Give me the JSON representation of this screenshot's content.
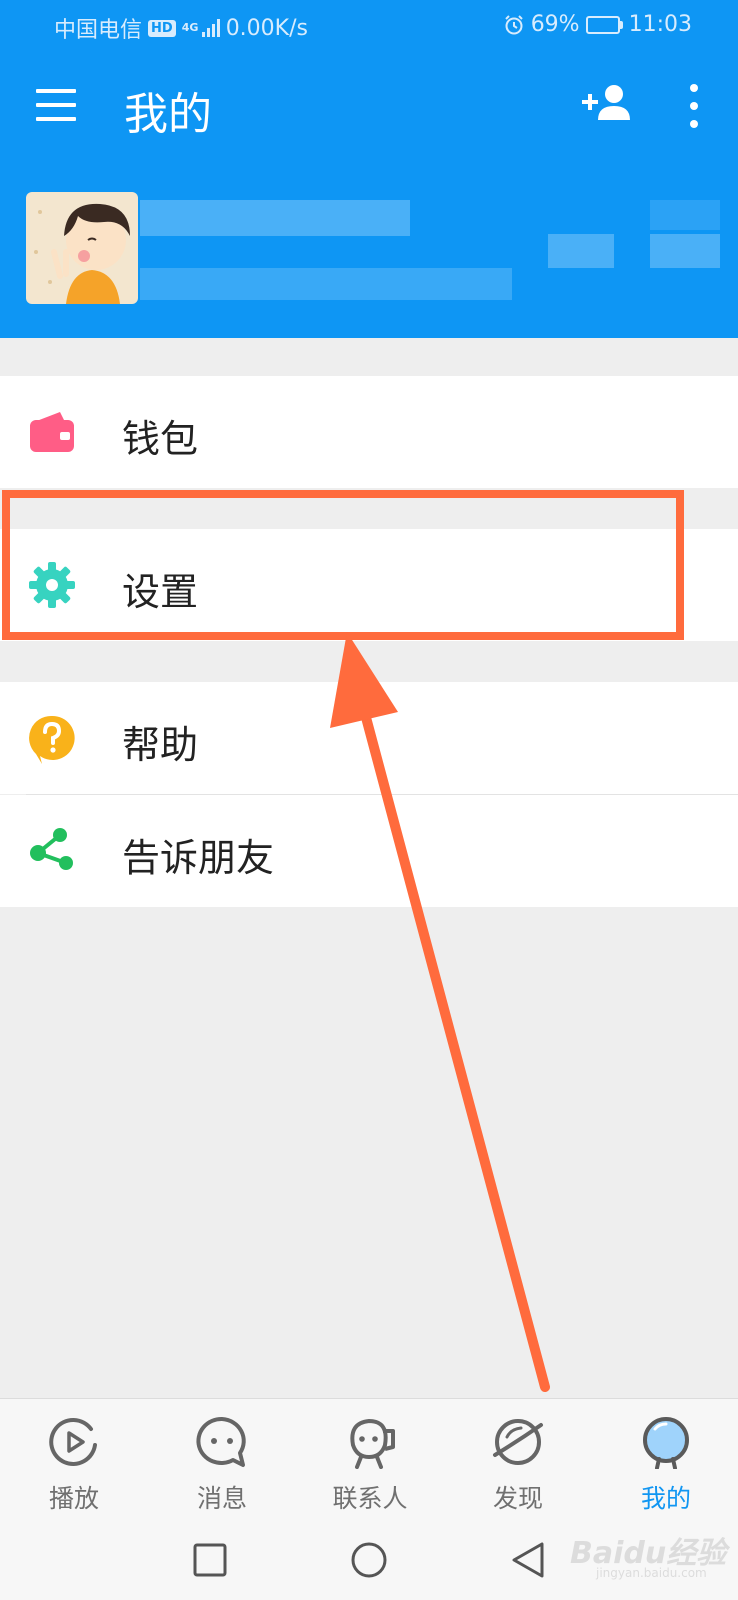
{
  "status_bar": {
    "carrier": "中国电信",
    "hd_badge": "HD",
    "network_type": "4G",
    "speed": "0.00K/s",
    "battery_percent": "69%",
    "battery_level": 0.69,
    "time": "11:03"
  },
  "app_bar": {
    "title": "我的",
    "icons": {
      "menu": "menu-icon",
      "add_friend": "add-friend-icon",
      "more": "more-vert-icon"
    }
  },
  "menu": {
    "items": [
      {
        "label": "钱包",
        "icon": "wallet-icon",
        "color": "#ff5d86"
      },
      {
        "label": "设置",
        "icon": "settings-gear-icon",
        "color": "#37d3c0"
      },
      {
        "label": "帮助",
        "icon": "help-icon",
        "color": "#f9b21a"
      },
      {
        "label": "告诉朋友",
        "icon": "share-icon",
        "color": "#22bf5d"
      }
    ]
  },
  "bottom_nav": {
    "items": [
      {
        "label": "播放",
        "icon": "play-icon"
      },
      {
        "label": "消息",
        "icon": "message-icon"
      },
      {
        "label": "联系人",
        "icon": "contacts-icon"
      },
      {
        "label": "发现",
        "icon": "discover-icon"
      },
      {
        "label": "我的",
        "icon": "profile-icon",
        "active": true
      }
    ]
  },
  "watermark": {
    "text": "Baidu经验",
    "sub": "jingyan.baidu.com"
  },
  "colors": {
    "header_blue": "#0e96f4",
    "active_tab": "#1196f2",
    "annotation_orange": "#ff6b3d",
    "page_background": "#eeeeee"
  }
}
